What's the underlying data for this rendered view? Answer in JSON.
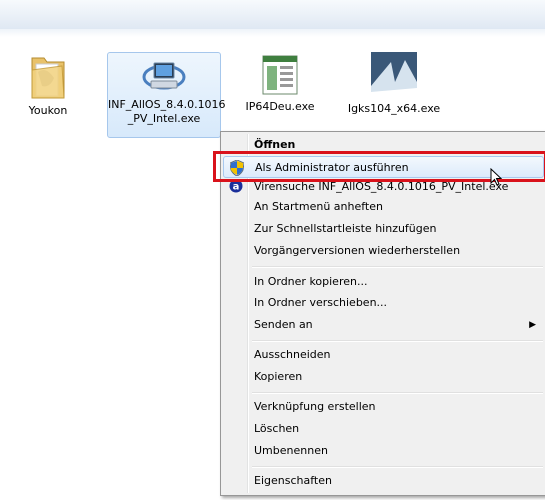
{
  "files": [
    {
      "name": "Youkon",
      "icon": "folder-icon"
    },
    {
      "name_line1": "INF_AllOS_8.4.0.1016",
      "name_line2": "_PV_Intel.exe",
      "icon": "setup-computer-icon",
      "selected": true
    },
    {
      "name": "IP64Deu.exe",
      "icon": "window-app-icon"
    },
    {
      "name": "Igks104_x64.exe",
      "icon": "intel-app-icon"
    }
  ],
  "context_menu": {
    "items": [
      {
        "label": "Öffnen",
        "bold": true
      },
      {
        "label": "Als Administrator ausführen",
        "icon": "uac-shield-icon",
        "highlighted": true
      },
      {
        "label": "Virensuche INF_AllOS_8.4.0.1016_PV_Intel.exe",
        "icon": "antivirus-icon"
      },
      {
        "label": "An Startmenü anheften"
      },
      {
        "label": "Zur Schnellstartleiste hinzufügen"
      },
      {
        "label": "Vorgängerversionen wiederherstellen"
      },
      {
        "label": "In Ordner kopieren..."
      },
      {
        "label": "In Ordner verschieben..."
      },
      {
        "label": "Senden an",
        "submenu": true,
        "arrow": "▶"
      },
      {
        "label": "Ausschneiden"
      },
      {
        "label": "Kopieren"
      },
      {
        "label": "Verknüpfung erstellen"
      },
      {
        "label": "Löschen"
      },
      {
        "label": "Umbenennen"
      },
      {
        "label": "Eigenschaften"
      }
    ]
  },
  "colors": {
    "highlight_box": "#d9121b",
    "menu_bg": "#f0f0f0"
  }
}
